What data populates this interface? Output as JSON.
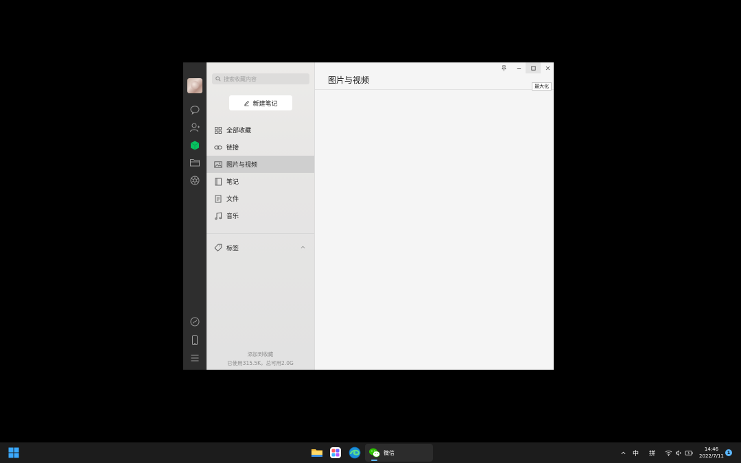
{
  "rail": {
    "icons": [
      "avatar",
      "chat-icon",
      "contacts-icon",
      "favorites-icon",
      "files-icon",
      "moments-icon",
      "mini-programs-icon",
      "phone-icon",
      "menu-icon"
    ]
  },
  "sidebar": {
    "search_placeholder": "搜索收藏内容",
    "new_note_label": "新建笔记",
    "items": [
      {
        "label": "全部收藏",
        "icon": "grid-icon"
      },
      {
        "label": "链接",
        "icon": "link-icon"
      },
      {
        "label": "图片与视频",
        "icon": "image-icon",
        "active": true
      },
      {
        "label": "笔记",
        "icon": "note-icon"
      },
      {
        "label": "文件",
        "icon": "file-icon"
      },
      {
        "label": "音乐",
        "icon": "music-icon"
      }
    ],
    "tags_label": "标签",
    "footer_add": "添加到收藏",
    "footer_usage": "已使用315.5K，总可用2.0G"
  },
  "main": {
    "title": "图片与视频",
    "tooltip": "最大化"
  },
  "taskbar": {
    "wechat_label": "微信",
    "ime_lang": "中",
    "ime_mode": "拼",
    "time": "14:46",
    "date": "2022/7/11",
    "notifications": "1"
  },
  "colors": {
    "rail_bg": "#2e2e2e",
    "favorites_accent": "#07c160",
    "active_item_bg": "#cfcfcf",
    "taskbar_bg": "#1c1c1c"
  }
}
